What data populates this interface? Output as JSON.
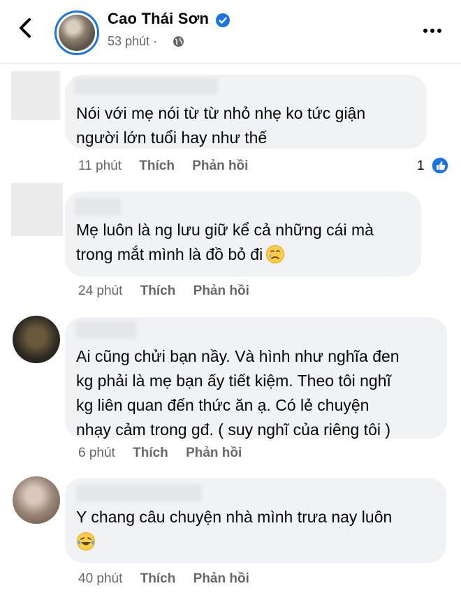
{
  "post": {
    "author": "Cao Thái Sơn",
    "time": "53 phút",
    "separator": "·"
  },
  "comments": [
    {
      "text_lines": [
        "Nói với mẹ nói từ từ nhỏ nhẹ ko tức giận",
        "người lớn tuổi hay như thế"
      ],
      "time": "11 phút",
      "like_label": "Thích",
      "reply_label": "Phản hồi",
      "reaction_count": "1"
    },
    {
      "text_lines": [
        "Mẹ luôn là ng lưu giữ kể cả những cái mà",
        "trong mắt mình là đồ bỏ đi"
      ],
      "emoji": "crying-face-icon",
      "time": "24 phút",
      "like_label": "Thích",
      "reply_label": "Phản hồi"
    },
    {
      "text_lines": [
        "Ai cũng chửi bạn nầy. Và hình như nghĩa đen",
        "kg phải là mẹ bạn ấy tiết kiệm. Theo tôi nghĩ",
        "kg liên quan đến thức ăn ạ. Có lẻ chuyện",
        "nhạy cảm trong gđ. ( suy nghĩ của riêng tôi )"
      ],
      "time": "6 phút",
      "like_label": "Thích",
      "reply_label": "Phản hồi"
    },
    {
      "text_lines": [
        "Y chang câu chuyện nhà mình trưa nay luôn"
      ],
      "emoji": "laughing-tears-icon",
      "time": "40 phút",
      "like_label": "Thích",
      "reply_label": "Phản hồi"
    }
  ],
  "colors": {
    "accent": "#1b74e4",
    "bubble": "#f0f2f5",
    "meta": "#65676b"
  }
}
